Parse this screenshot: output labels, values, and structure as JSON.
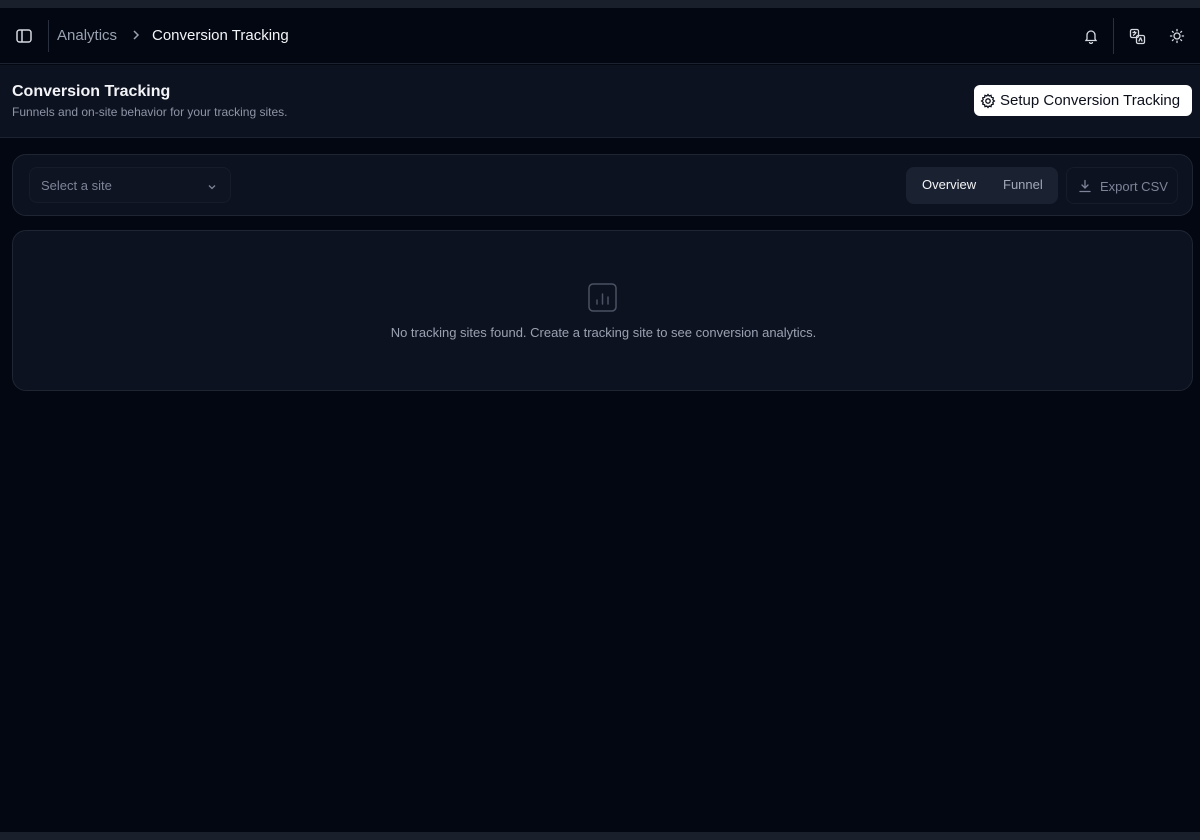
{
  "topbar": {
    "breadcrumb_root": "Analytics",
    "breadcrumb_current": "Conversion Tracking",
    "icons": [
      "sidebar-toggle-icon",
      "chevron-right-icon",
      "bell-icon",
      "translate-icon",
      "sun-icon"
    ]
  },
  "page": {
    "title": "Conversion Tracking",
    "subtitle": "Funnels and on-site behavior for your tracking sites.",
    "setup_button": "Setup Conversion Tracking"
  },
  "toolbar": {
    "site_select_placeholder": "Select a site",
    "tabs": [
      {
        "label": "Overview",
        "active": true
      },
      {
        "label": "Funnel",
        "active": false
      }
    ],
    "export_button": "Export CSV"
  },
  "empty_state": {
    "message": "No tracking sites found. Create a tracking site to see conversion analytics.",
    "icon": "bar-chart-icon"
  },
  "colors": {
    "background": "#030712",
    "surface": "#0d1220",
    "border": "#1f2533",
    "primary_button": "#ffffff",
    "muted_text": "#8d94a5"
  }
}
